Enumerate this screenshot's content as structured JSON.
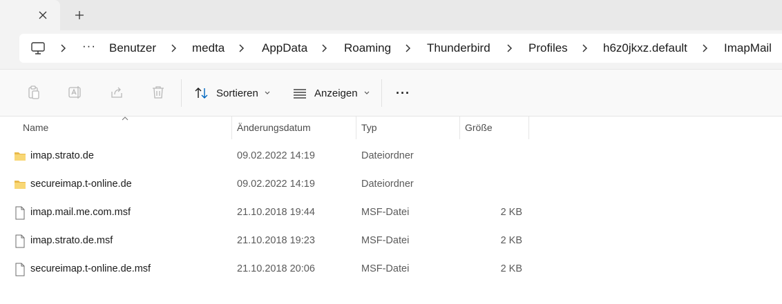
{
  "window": {
    "new_tab_label": "+",
    "close_tab_label": "×"
  },
  "address_bar": {
    "overflow_label": "···",
    "crumbs": [
      "Benutzer",
      "medta",
      "AppData",
      "Roaming",
      "Thunderbird",
      "Profiles",
      "h6z0jkxz.default",
      "ImapMail"
    ]
  },
  "toolbar": {
    "sort_label": "Sortieren",
    "view_label": "Anzeigen",
    "more_label": "···"
  },
  "columns": {
    "name": "Name",
    "date": "Änderungsdatum",
    "type": "Typ",
    "size": "Größe"
  },
  "files": [
    {
      "name": "imap.strato.de",
      "date": "09.02.2022 14:19",
      "type": "Dateiordner",
      "size": "",
      "icon": "folder-icon"
    },
    {
      "name": "secureimap.t-online.de",
      "date": "09.02.2022 14:19",
      "type": "Dateiordner",
      "size": "",
      "icon": "folder-icon"
    },
    {
      "name": "imap.mail.me.com.msf",
      "date": "21.10.2018 19:44",
      "type": "MSF-Datei",
      "size": "2 KB",
      "icon": "file-icon"
    },
    {
      "name": "imap.strato.de.msf",
      "date": "21.10.2018 19:23",
      "type": "MSF-Datei",
      "size": "2 KB",
      "icon": "file-icon"
    },
    {
      "name": "secureimap.t-online.de.msf",
      "date": "21.10.2018 20:06",
      "type": "MSF-Datei",
      "size": "2 KB",
      "icon": "file-icon"
    }
  ],
  "colors": {
    "folder": "#f8d775",
    "folder_dark": "#e9b949",
    "accent": "#0067c0"
  }
}
